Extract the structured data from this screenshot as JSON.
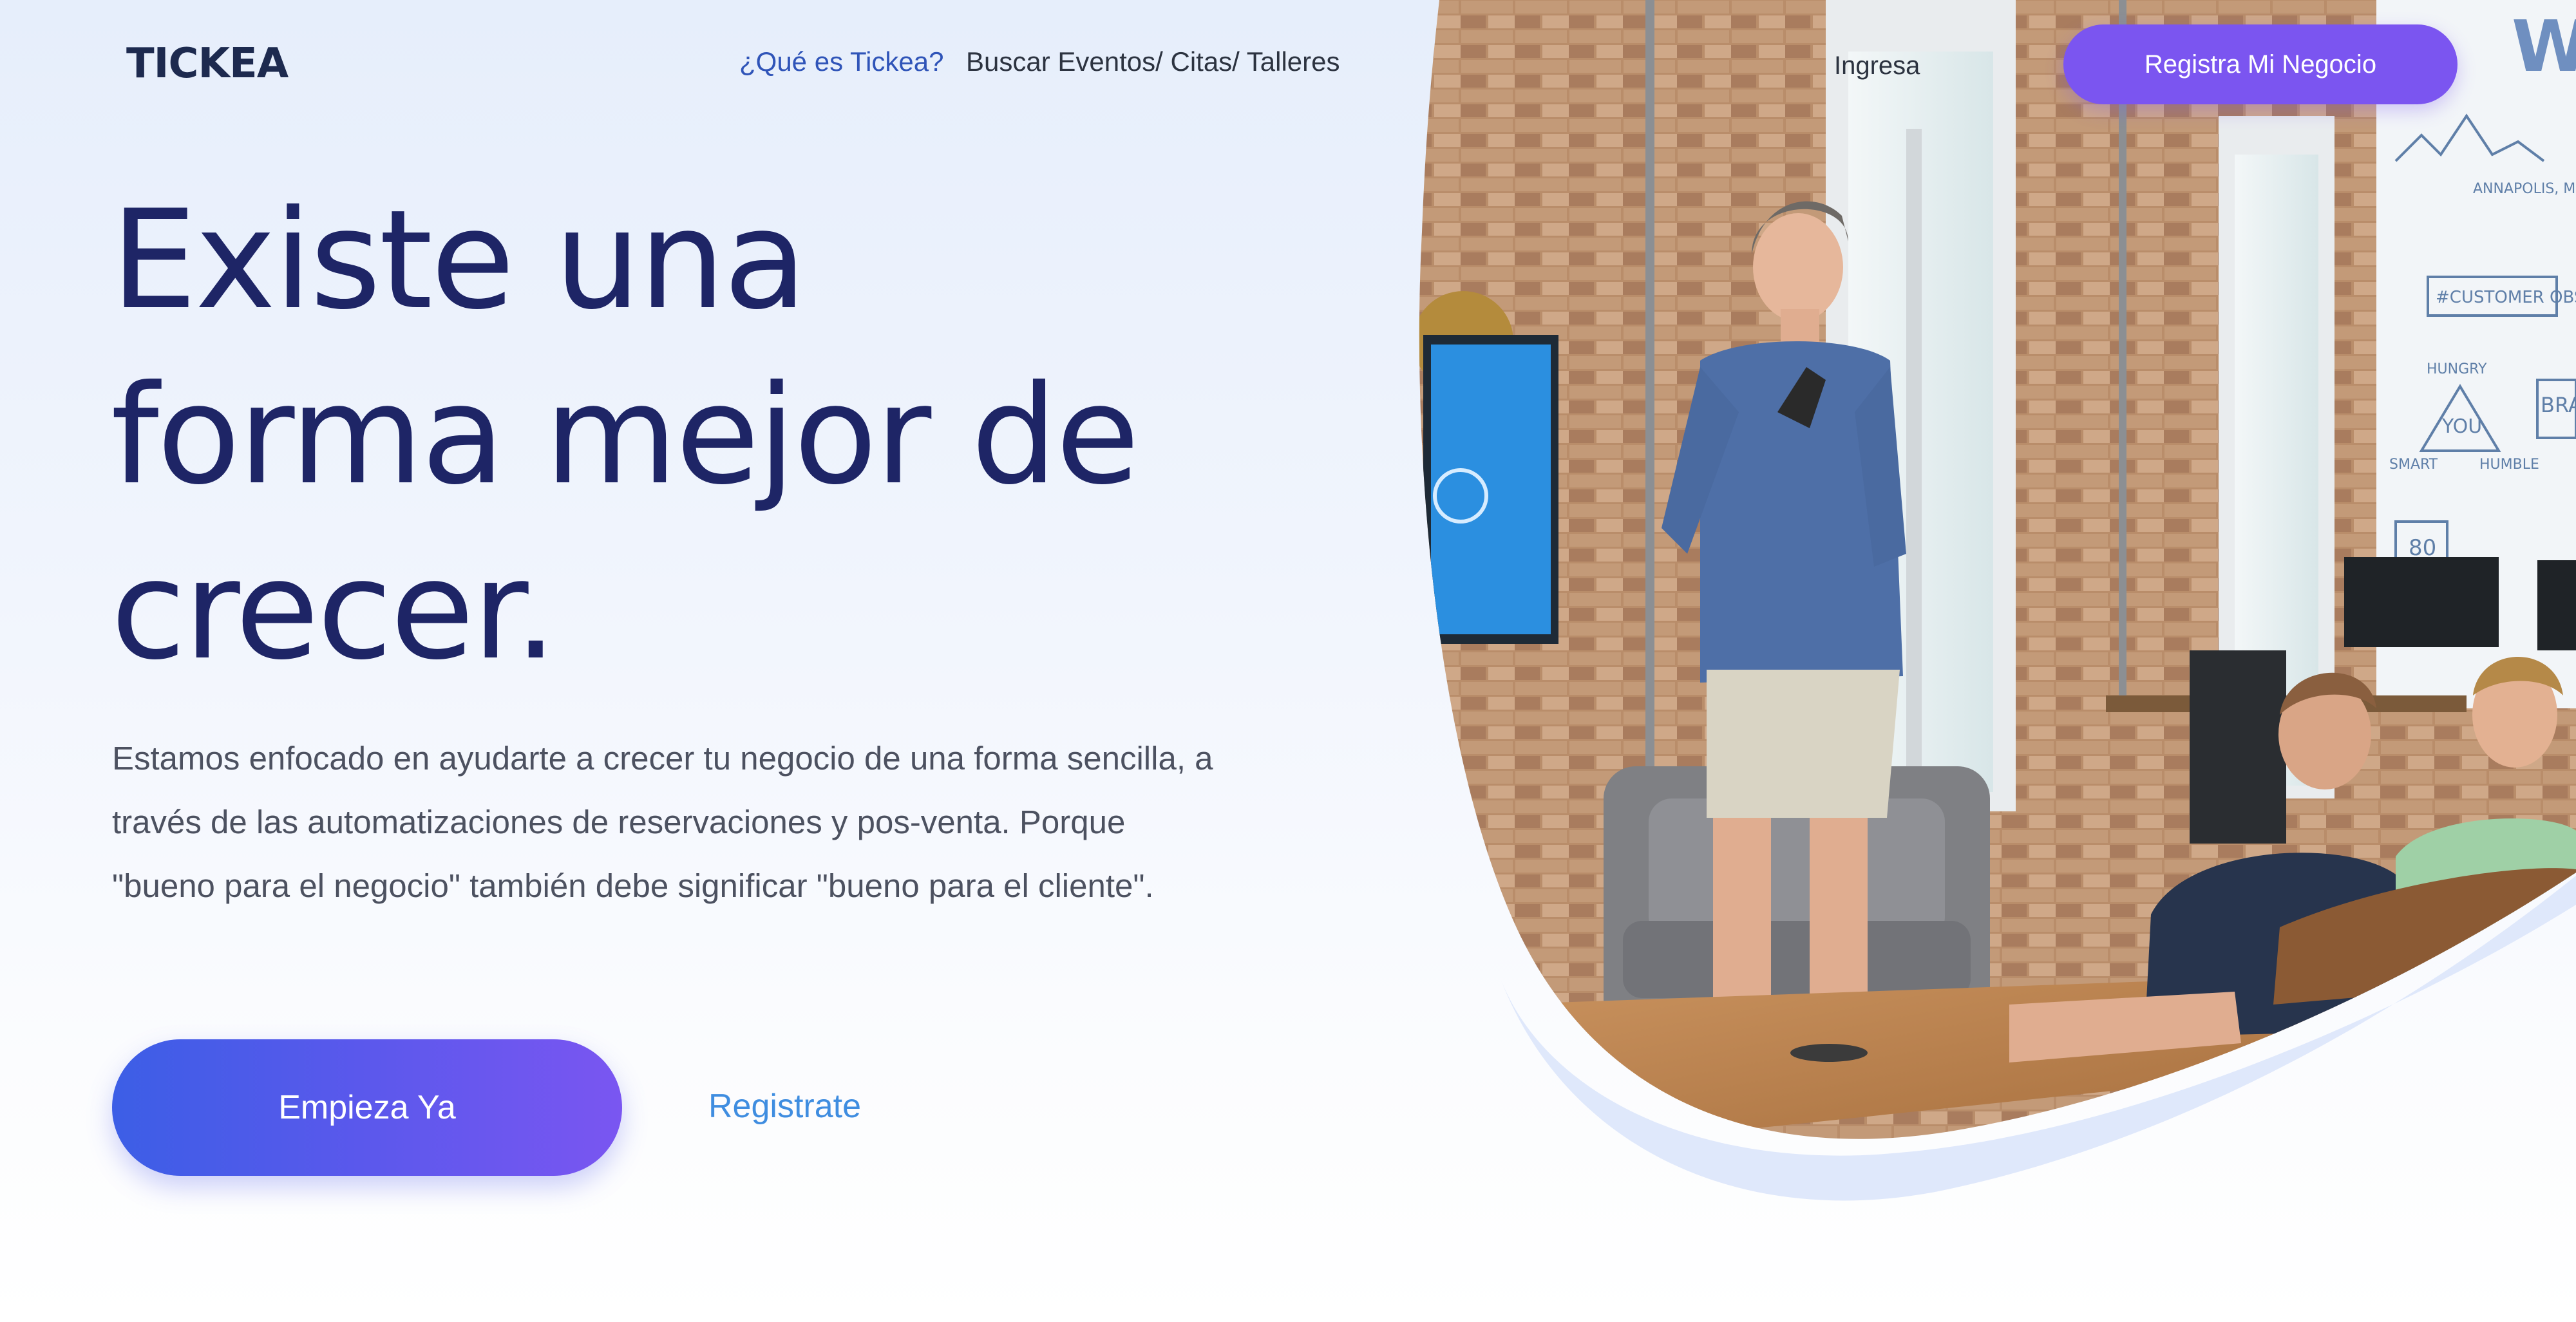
{
  "header": {
    "logo": "TICKEA",
    "nav": {
      "what_is": "¿Qué es Tickea?",
      "search": "Buscar Eventos/ Citas/ Talleres",
      "login": "Ingresa"
    },
    "cta": "Registra Mi Negocio"
  },
  "hero": {
    "headline_lines": [
      "Existe una",
      "forma mejor de",
      "crecer."
    ],
    "description": "Estamos enfocado en ayudarte a crecer tu negocio de una forma sencilla, a través de las automatizaciones de reservaciones y pos-venta. Porque \"bueno para el negocio\" también debe significar \"bueno para el cliente\".",
    "primary_button": "Empieza Ya",
    "secondary_link": "Registrate"
  },
  "photo": {
    "whiteboard_texts": [
      "ANNAPOLIS, MD",
      "#CUSTOMER OBSESS",
      "HUNGRY",
      "YOU",
      "SMART",
      "HUMBLE",
      "BRA",
      "80"
    ]
  },
  "colors": {
    "brand_purple": "#7b55f0",
    "gradient_start": "#3c5ee6",
    "gradient_end": "#7a56f1",
    "headline": "#1e2566",
    "link_blue": "#3f8de0"
  }
}
